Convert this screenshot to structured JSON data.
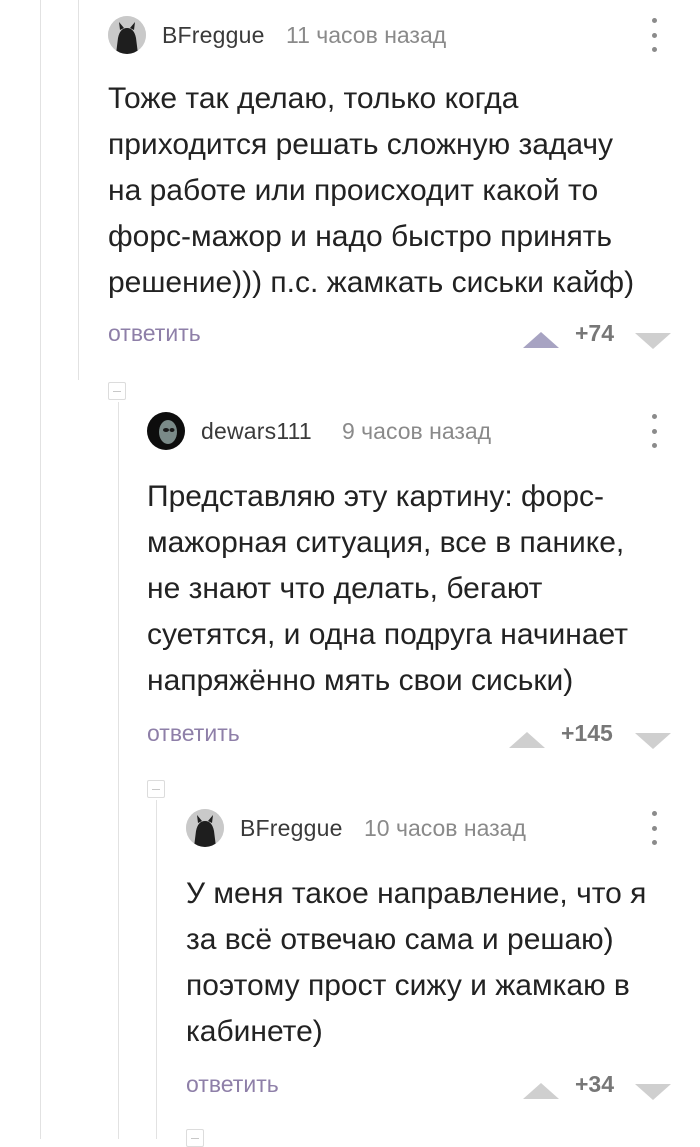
{
  "comments": [
    {
      "username": "BFreggue",
      "time": "11 часов назад",
      "text": "Тоже так делаю, только когда\nприходится решать сложную задачу\nна работе или происходит какой то\nфорс-мажор и надо быстро принять\nрешение))) п.с. жамкать сиськи кайф)",
      "reply_label": "ответить",
      "score": "+74",
      "upvoted": true
    },
    {
      "username": "dewars111",
      "time": "9 часов назад",
      "text": "Представляю эту картину: форс-\nмажорная ситуация, все в панике,\nне знают что делать, бегают\nсуетятся, и одна подруга начинает\nнапряжённо мять свои сиськи)",
      "reply_label": "ответить",
      "score": "+145",
      "upvoted": false
    },
    {
      "username": "BFreggue",
      "time": "10 часов назад",
      "text": "У меня такое направление, что я\nза всё отвечаю сама и решаю)\nпоэтому прост сижу и жамкаю в\nкабинете)",
      "reply_label": "ответить",
      "score": "+34",
      "upvoted": false
    }
  ],
  "colors": {
    "reply_link": "#8e7fa8",
    "upvote_active": "#a7a3c2",
    "vote_inactive": "#cfcfcf"
  }
}
